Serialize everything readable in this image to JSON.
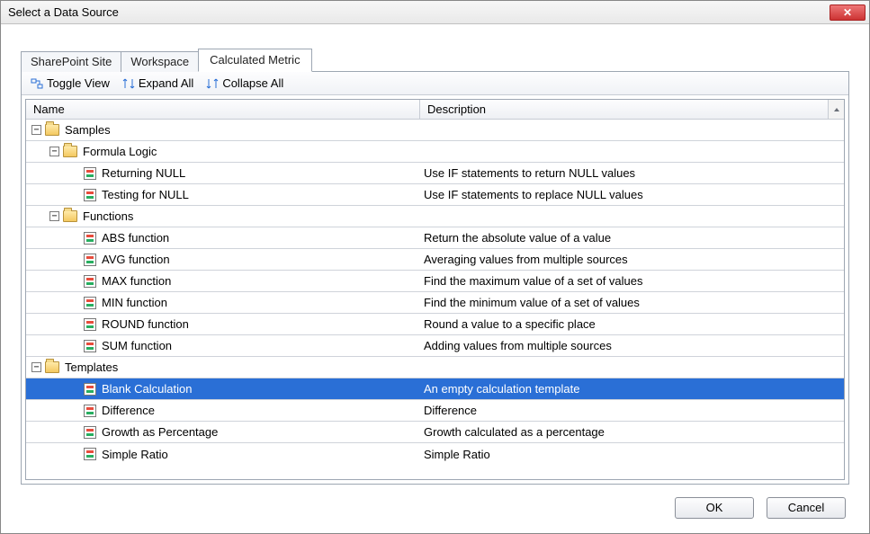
{
  "window": {
    "title": "Select a Data Source"
  },
  "tabs": [
    {
      "label": "SharePoint Site",
      "active": false
    },
    {
      "label": "Workspace",
      "active": false
    },
    {
      "label": "Calculated Metric",
      "active": true
    }
  ],
  "toolbar": {
    "toggle": "Toggle View",
    "expand": "Expand All",
    "collapse": "Collapse All"
  },
  "columns": {
    "name": "Name",
    "description": "Description"
  },
  "tree": [
    {
      "type": "folder",
      "level": 0,
      "expanded": true,
      "name": "Samples",
      "desc": ""
    },
    {
      "type": "folder",
      "level": 1,
      "expanded": true,
      "name": "Formula Logic",
      "desc": ""
    },
    {
      "type": "item",
      "level": 2,
      "name": "Returning NULL",
      "desc": "Use IF statements to return NULL values"
    },
    {
      "type": "item",
      "level": 2,
      "name": "Testing for NULL",
      "desc": "Use IF statements to replace NULL values"
    },
    {
      "type": "folder",
      "level": 1,
      "expanded": true,
      "name": "Functions",
      "desc": ""
    },
    {
      "type": "item",
      "level": 2,
      "name": "ABS function",
      "desc": "Return the absolute value of a value"
    },
    {
      "type": "item",
      "level": 2,
      "name": "AVG function",
      "desc": "Averaging values from multiple sources"
    },
    {
      "type": "item",
      "level": 2,
      "name": "MAX function",
      "desc": "Find the maximum value of a set of values"
    },
    {
      "type": "item",
      "level": 2,
      "name": "MIN function",
      "desc": "Find the minimum value of a set of values"
    },
    {
      "type": "item",
      "level": 2,
      "name": "ROUND function",
      "desc": "Round a value to a specific place"
    },
    {
      "type": "item",
      "level": 2,
      "name": "SUM function",
      "desc": "Adding values from multiple sources"
    },
    {
      "type": "folder",
      "level": 0,
      "expanded": true,
      "name": "Templates",
      "desc": ""
    },
    {
      "type": "item",
      "level": 2,
      "name": "Blank Calculation",
      "desc": "An empty calculation template",
      "selected": true
    },
    {
      "type": "item",
      "level": 2,
      "name": "Difference",
      "desc": "Difference"
    },
    {
      "type": "item",
      "level": 2,
      "name": "Growth as Percentage",
      "desc": "Growth calculated as a percentage"
    },
    {
      "type": "item",
      "level": 2,
      "name": "Simple Ratio",
      "desc": "Simple Ratio"
    }
  ],
  "buttons": {
    "ok": "OK",
    "cancel": "Cancel"
  }
}
